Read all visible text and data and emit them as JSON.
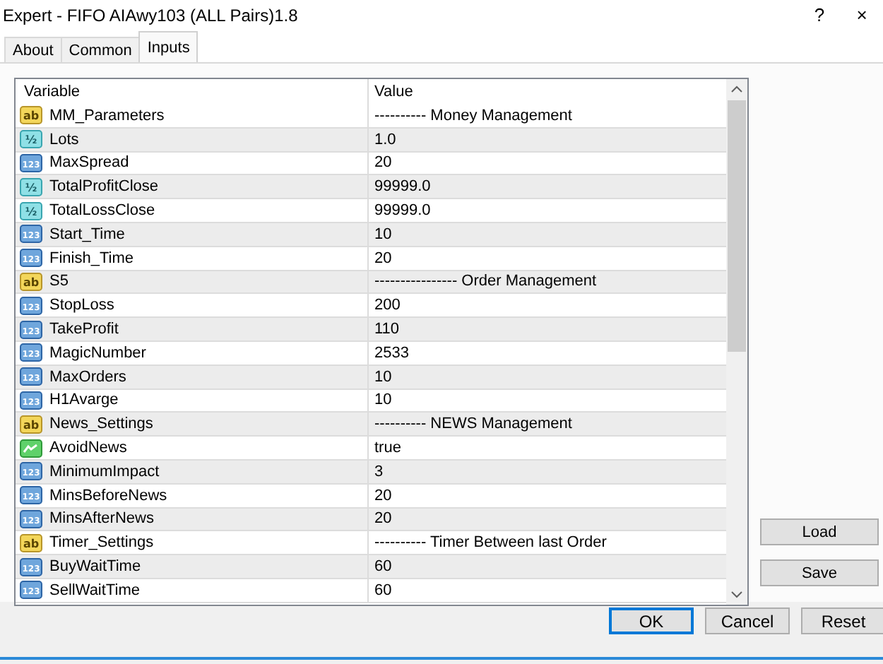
{
  "window": {
    "title": "Expert - FIFO AIAwy103 (ALL Pairs)1.8",
    "help": "?",
    "close": "×"
  },
  "tabs": [
    {
      "label": "About",
      "selected": false
    },
    {
      "label": "Common",
      "selected": false
    },
    {
      "label": "Inputs",
      "selected": true
    }
  ],
  "table": {
    "columns": [
      "Variable",
      "Value"
    ],
    "rows": [
      {
        "kind": "string",
        "icon": "ab",
        "variable": "MM_Parameters",
        "value": "---------- Money Management"
      },
      {
        "kind": "double",
        "icon": "½",
        "variable": "Lots",
        "value": "1.0"
      },
      {
        "kind": "int",
        "icon": "123",
        "variable": "MaxSpread",
        "value": "20"
      },
      {
        "kind": "double",
        "icon": "½",
        "variable": "TotalProfitClose",
        "value": "99999.0"
      },
      {
        "kind": "double",
        "icon": "½",
        "variable": "TotalLossClose",
        "value": "99999.0"
      },
      {
        "kind": "int",
        "icon": "123",
        "variable": "Start_Time",
        "value": "10"
      },
      {
        "kind": "int",
        "icon": "123",
        "variable": "Finish_Time",
        "value": "20"
      },
      {
        "kind": "string",
        "icon": "ab",
        "variable": "S5",
        "value": "---------------- Order Management"
      },
      {
        "kind": "int",
        "icon": "123",
        "variable": "StopLoss",
        "value": "200"
      },
      {
        "kind": "int",
        "icon": "123",
        "variable": "TakeProfit",
        "value": "110"
      },
      {
        "kind": "int",
        "icon": "123",
        "variable": "MagicNumber",
        "value": "2533"
      },
      {
        "kind": "int",
        "icon": "123",
        "variable": "MaxOrders",
        "value": "10"
      },
      {
        "kind": "int",
        "icon": "123",
        "variable": "H1Avarge",
        "value": "10"
      },
      {
        "kind": "string",
        "icon": "ab",
        "variable": "News_Settings",
        "value": "---------- NEWS Management"
      },
      {
        "kind": "bool",
        "variable": "AvoidNews",
        "value": "true"
      },
      {
        "kind": "int",
        "icon": "123",
        "variable": "MinimumImpact",
        "value": "3"
      },
      {
        "kind": "int",
        "icon": "123",
        "variable": "MinsBeforeNews",
        "value": "20"
      },
      {
        "kind": "int",
        "icon": "123",
        "variable": "MinsAfterNews",
        "value": "20"
      },
      {
        "kind": "string",
        "icon": "ab",
        "variable": "Timer_Settings",
        "value": "---------- Timer Between last Order"
      },
      {
        "kind": "int",
        "icon": "123",
        "variable": "BuyWaitTime",
        "value": "60"
      },
      {
        "kind": "int",
        "icon": "123",
        "variable": "SellWaitTime",
        "value": "60"
      }
    ]
  },
  "side_buttons": [
    "Load",
    "Save"
  ],
  "buttons": [
    {
      "label": "OK",
      "default": true
    },
    {
      "label": "Cancel",
      "default": false
    },
    {
      "label": "Reset",
      "default": false
    }
  ]
}
